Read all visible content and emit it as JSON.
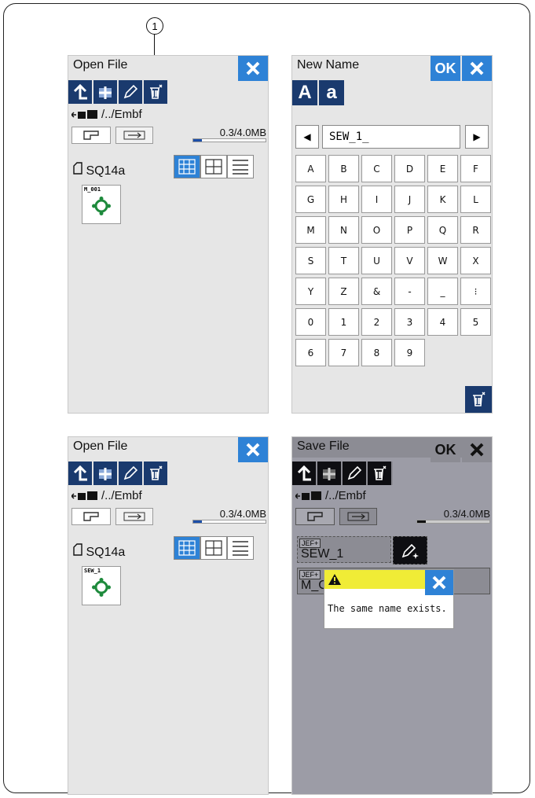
{
  "callout": "1",
  "open_file": {
    "title": "Open File",
    "path": "/../Embf",
    "memory": "0.3/4.0MB",
    "folder": "SQ14a",
    "file_label": "M_001"
  },
  "new_name": {
    "title": "New Name",
    "ok": "OK",
    "upper": "A",
    "lower": "a",
    "entry": "SEW_1_",
    "keys": [
      "A",
      "B",
      "C",
      "D",
      "E",
      "F",
      "G",
      "H",
      "I",
      "J",
      "K",
      "L",
      "M",
      "N",
      "O",
      "P",
      "Q",
      "R",
      "S",
      "T",
      "U",
      "V",
      "W",
      "X",
      "Y",
      "Z",
      "&",
      "-",
      "_",
      "⁝",
      "0",
      "1",
      "2",
      "3",
      "4",
      "5",
      "6",
      "7",
      "8",
      "9"
    ]
  },
  "open_file_after": {
    "title": "Open File",
    "path": "/../Embf",
    "memory": "0.3/4.0MB",
    "folder": "SQ14a",
    "file_label": "SEW_1"
  },
  "save_file": {
    "title": "Save File",
    "ok": "OK",
    "path": "/../Embf",
    "memory": "0.3/4.0MB",
    "jef": "JEF+",
    "file1": "SEW_1",
    "file2": "M_C",
    "message": "The same name exists."
  },
  "colors": {
    "accent": "#2e82d6",
    "toolbar": "#1a3a6e",
    "warning": "#f0ec36",
    "pattern": "#1e8a3c"
  }
}
